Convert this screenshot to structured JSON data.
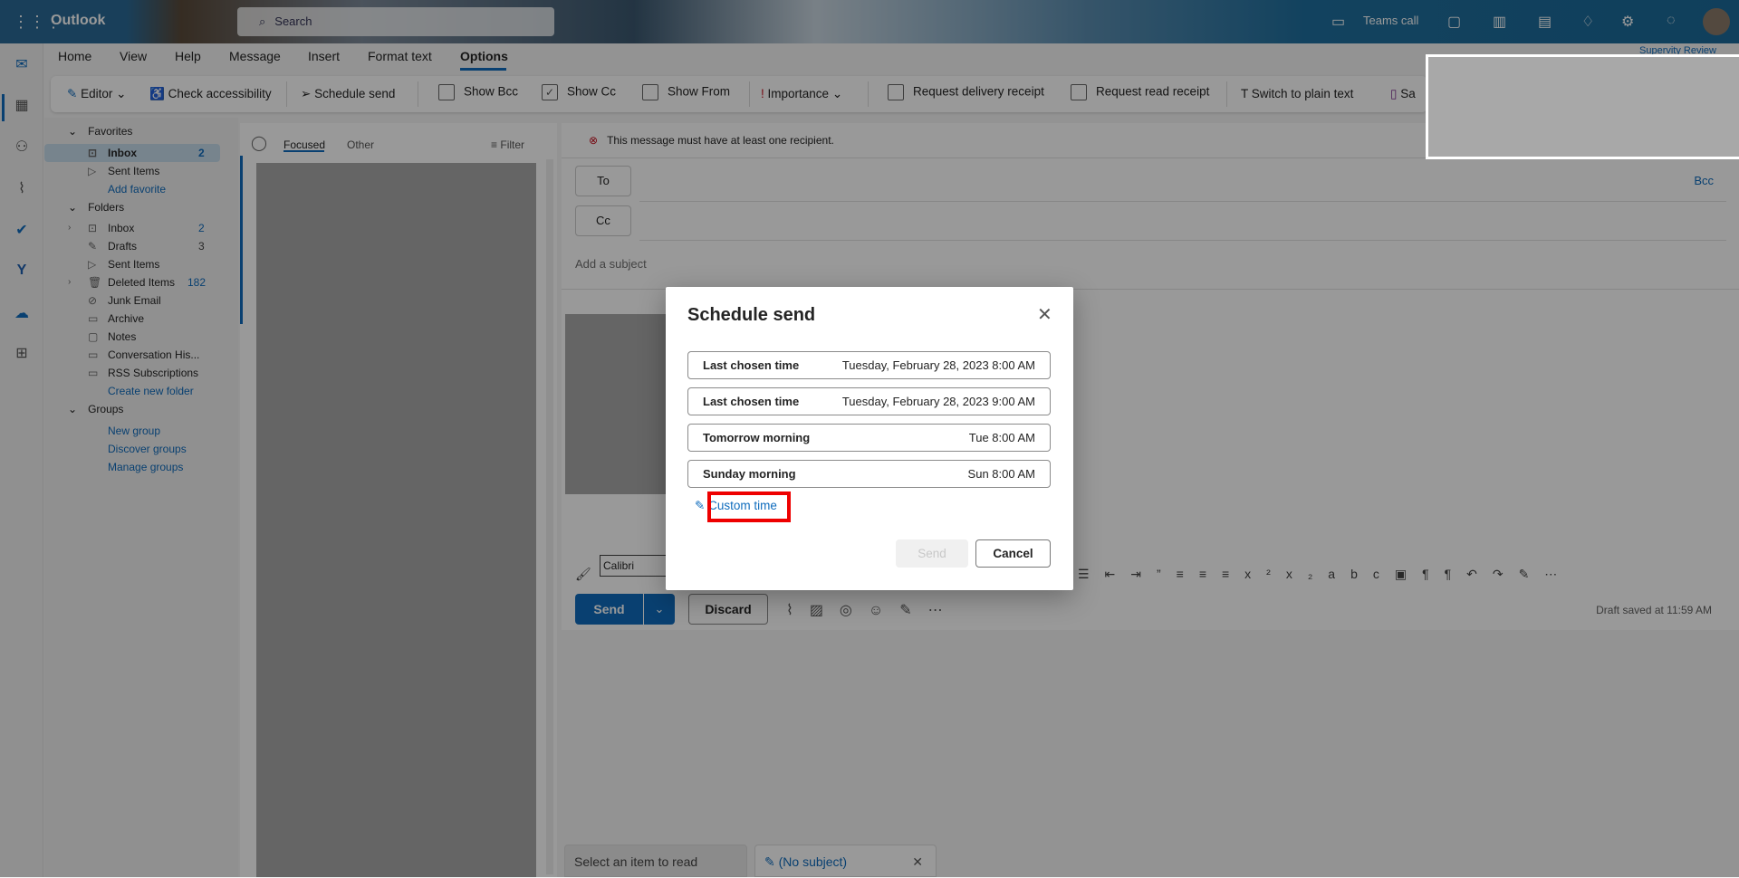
{
  "app": {
    "title": "Outlook",
    "search_placeholder": "Search",
    "teams_call": "Teams call",
    "account_label": "Supervity Review"
  },
  "menu_tabs": [
    "Home",
    "View",
    "Help",
    "Message",
    "Insert",
    "Format text",
    "Options"
  ],
  "selected_tab": "Options",
  "ribbon": {
    "editor": "Editor",
    "check_accessibility": "Check accessibility",
    "schedule_send": "Schedule send",
    "show_bcc": "Show Bcc",
    "show_bcc_checked": false,
    "show_cc": "Show Cc",
    "show_cc_checked": true,
    "show_from": "Show From",
    "show_from_checked": false,
    "importance": "Importance",
    "request_delivery_receipt": "Request delivery receipt",
    "request_read_receipt": "Request read receipt",
    "switch_plain_text": "Switch to plain text",
    "save_partial": "Sa"
  },
  "folders": {
    "favorites_label": "Favorites",
    "favorites": [
      {
        "label": "Inbox",
        "count": "2"
      },
      {
        "label": "Sent Items",
        "count": ""
      }
    ],
    "add_favorite": "Add favorite",
    "folders_label": "Folders",
    "items": [
      {
        "label": "Inbox",
        "count": "2"
      },
      {
        "label": "Drafts",
        "count": "3"
      },
      {
        "label": "Sent Items",
        "count": ""
      },
      {
        "label": "Deleted Items",
        "count": "182"
      },
      {
        "label": "Junk Email",
        "count": ""
      },
      {
        "label": "Archive",
        "count": ""
      },
      {
        "label": "Notes",
        "count": ""
      },
      {
        "label": "Conversation His...",
        "count": ""
      },
      {
        "label": "RSS Subscriptions",
        "count": ""
      }
    ],
    "create_new_folder": "Create new folder",
    "groups_label": "Groups",
    "groups_links": [
      "New group",
      "Discover groups",
      "Manage groups"
    ]
  },
  "message_list": {
    "focused": "Focused",
    "other": "Other",
    "filter": "Filter"
  },
  "compose": {
    "error": "This message must have at least one recipient.",
    "to": "To",
    "cc": "Cc",
    "bcc": "Bcc",
    "subject_placeholder": "Add a subject",
    "font": "Calibri",
    "send": "Send",
    "discard": "Discard",
    "draft_saved": "Draft saved at 11:59 AM"
  },
  "bottom_tabs": {
    "select_item": "Select an item to read",
    "draft_tab": "(No subject)"
  },
  "dialog": {
    "title": "Schedule send",
    "options": [
      {
        "label": "Last chosen time",
        "time": "Tuesday, February 28, 2023 8:00 AM"
      },
      {
        "label": "Last chosen time",
        "time": "Tuesday, February 28, 2023 9:00 AM"
      },
      {
        "label": "Tomorrow morning",
        "time": "Tue 8:00 AM"
      },
      {
        "label": "Sunday morning",
        "time": "Sun 8:00 AM"
      }
    ],
    "custom_time": "Custom time",
    "send": "Send",
    "cancel": "Cancel"
  },
  "colors": {
    "accent": "#0f6cbd",
    "highlight_box": "#e00000",
    "error": "#c50f1f"
  }
}
